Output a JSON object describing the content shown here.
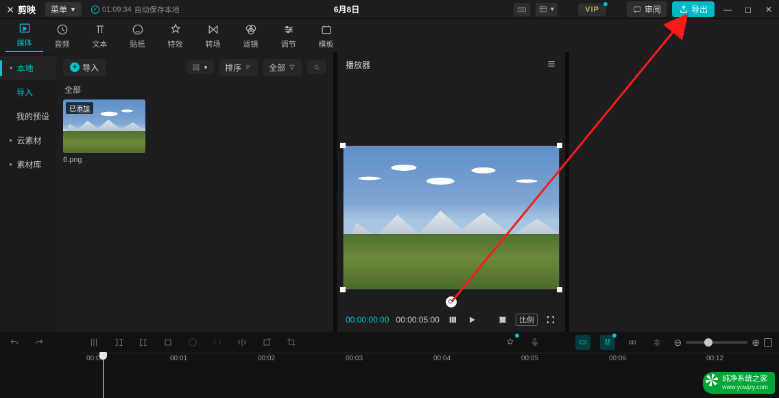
{
  "titlebar": {
    "app_name": "剪映",
    "menu_label": "菜单",
    "autosave_time": "01:09:34",
    "autosave_text": "自动保存本地",
    "project_title": "6月8日",
    "vip_label": "VIP",
    "review_label": "审阅",
    "export_label": "导出"
  },
  "tooltabs": [
    {
      "key": "media",
      "label": "媒体"
    },
    {
      "key": "audio",
      "label": "音频"
    },
    {
      "key": "text",
      "label": "文本"
    },
    {
      "key": "sticker",
      "label": "贴纸"
    },
    {
      "key": "effect",
      "label": "特效"
    },
    {
      "key": "transition",
      "label": "转场"
    },
    {
      "key": "filter",
      "label": "滤镜"
    },
    {
      "key": "adjust",
      "label": "调节"
    },
    {
      "key": "template",
      "label": "模板"
    }
  ],
  "left_nav": [
    {
      "key": "local",
      "label": "本地",
      "active": true
    },
    {
      "key": "import",
      "label": "导入",
      "sub": true
    },
    {
      "key": "preset",
      "label": "我的预设",
      "sub": true
    },
    {
      "key": "cloud",
      "label": "云素材"
    },
    {
      "key": "library",
      "label": "素材库"
    }
  ],
  "asset_panel": {
    "import_label": "导入",
    "sort_label": "排序",
    "filter_all": "全部",
    "section_all": "全部",
    "thumb_tag": "已添加",
    "thumb_name": "6.png"
  },
  "player": {
    "title": "播放器",
    "tc_current": "00:00:00:00",
    "tc_total": "00:00:05:00",
    "ratio_label": "比例"
  },
  "timeline": {
    "ticks": [
      "00:00",
      "00:01",
      "00:02",
      "00:03",
      "00:04",
      "00:05",
      "00:06",
      "00:12"
    ]
  },
  "watermark": {
    "brand": "纯净系统之家",
    "url": "www.ycwjzy.com"
  }
}
